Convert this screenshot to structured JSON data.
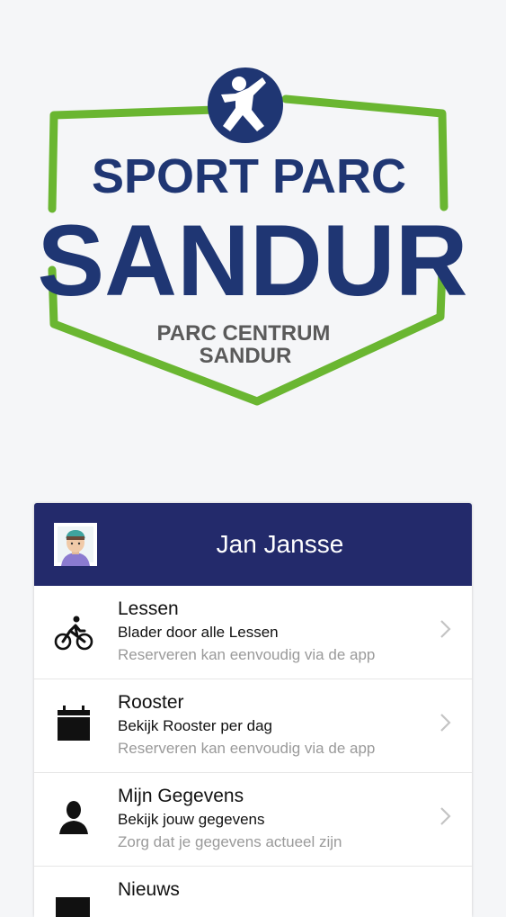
{
  "logo": {
    "line1": "SPORT PARC",
    "line2": "SANDUR",
    "line3": "PARC CENTRUM",
    "line4": "SANDUR"
  },
  "user": {
    "name": "Jan Jansse"
  },
  "menu": [
    {
      "title": "Lessen",
      "subtitle": "Blader door alle Lessen",
      "note": "Reserveren kan eenvoudig via de app",
      "icon": "bicycle-icon"
    },
    {
      "title": "Rooster",
      "subtitle": "Bekijk Rooster per dag",
      "note": "Reserveren kan eenvoudig via de app",
      "icon": "calendar-icon"
    },
    {
      "title": "Mijn Gegevens",
      "subtitle": "Bekijk jouw gegevens",
      "note": "Zorg dat je gegevens actueel zijn",
      "icon": "person-icon"
    },
    {
      "title": "Nieuws",
      "subtitle": "",
      "note": "",
      "icon": "news-icon"
    }
  ],
  "colors": {
    "header": "#232a6b",
    "brand_blue": "#1f3673",
    "brand_green": "#6ab631"
  }
}
